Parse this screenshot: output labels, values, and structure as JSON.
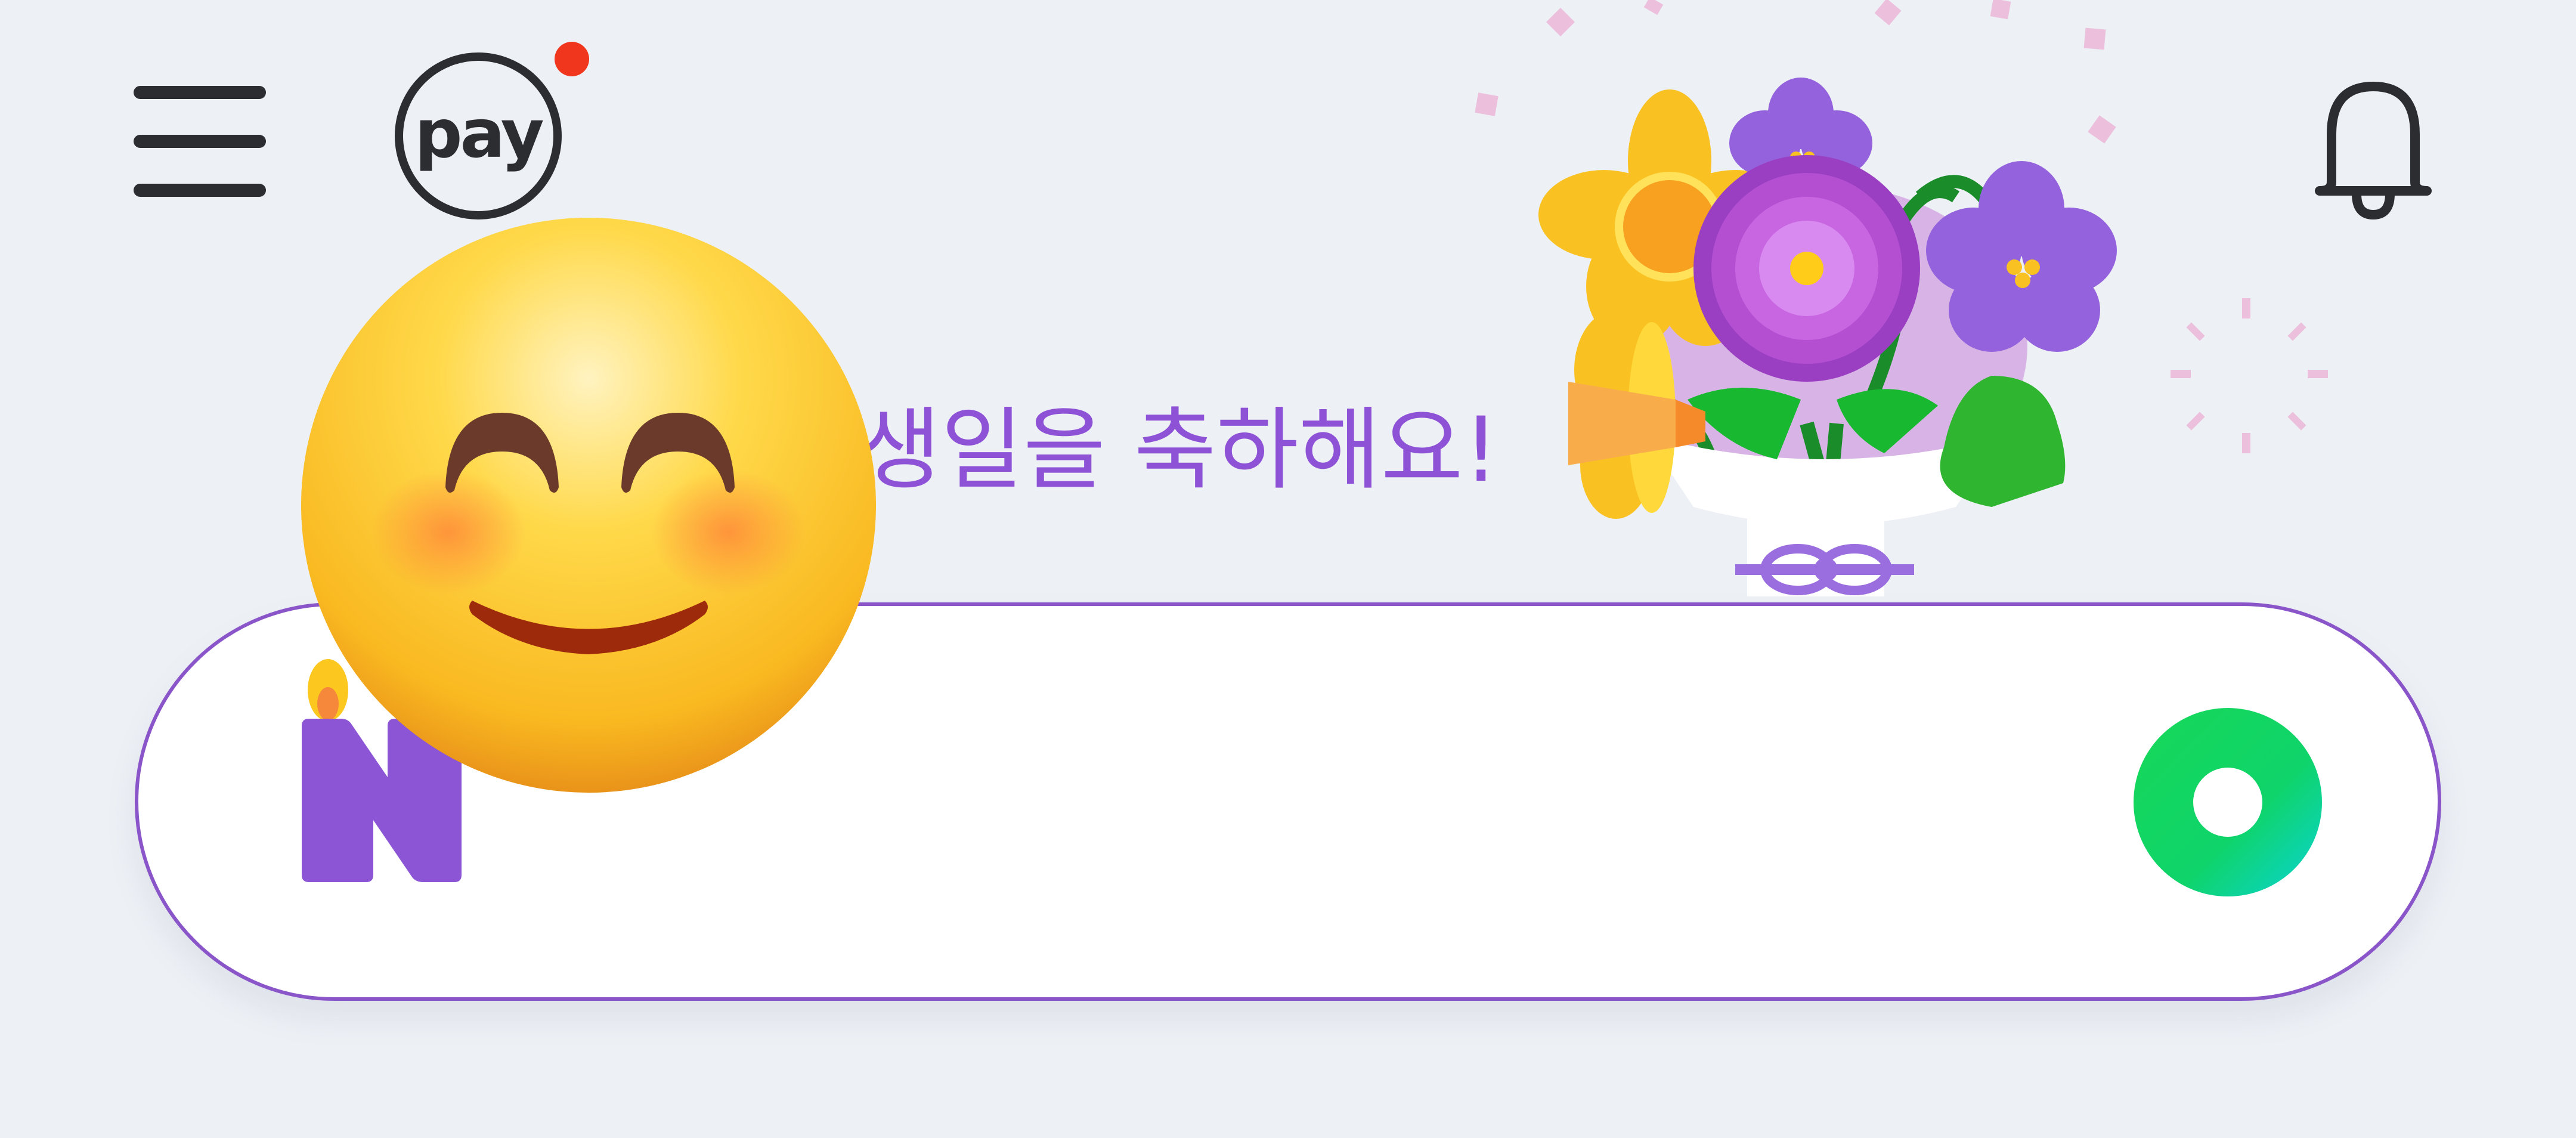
{
  "header": {
    "menu_icon": "hamburger-menu-icon",
    "pay_label": "pay",
    "pay_badge_color": "#f0371e",
    "bell_icon": "bell-icon"
  },
  "greeting": {
    "text": "생일을 축하해요!",
    "color": "#8e52d6"
  },
  "search": {
    "value": "",
    "border_color": "#8a55c9",
    "logo_icon": "birthday-candle-n-logo-icon",
    "submit_icon": "green-search-button-icon",
    "submit_color": "#0fd46a"
  },
  "decorations": {
    "emoji": "smiling-face-emoji",
    "bouquet": "flower-bouquet-illustration"
  },
  "colors": {
    "background": "#edf0f5",
    "accent_purple": "#8e52d6"
  }
}
